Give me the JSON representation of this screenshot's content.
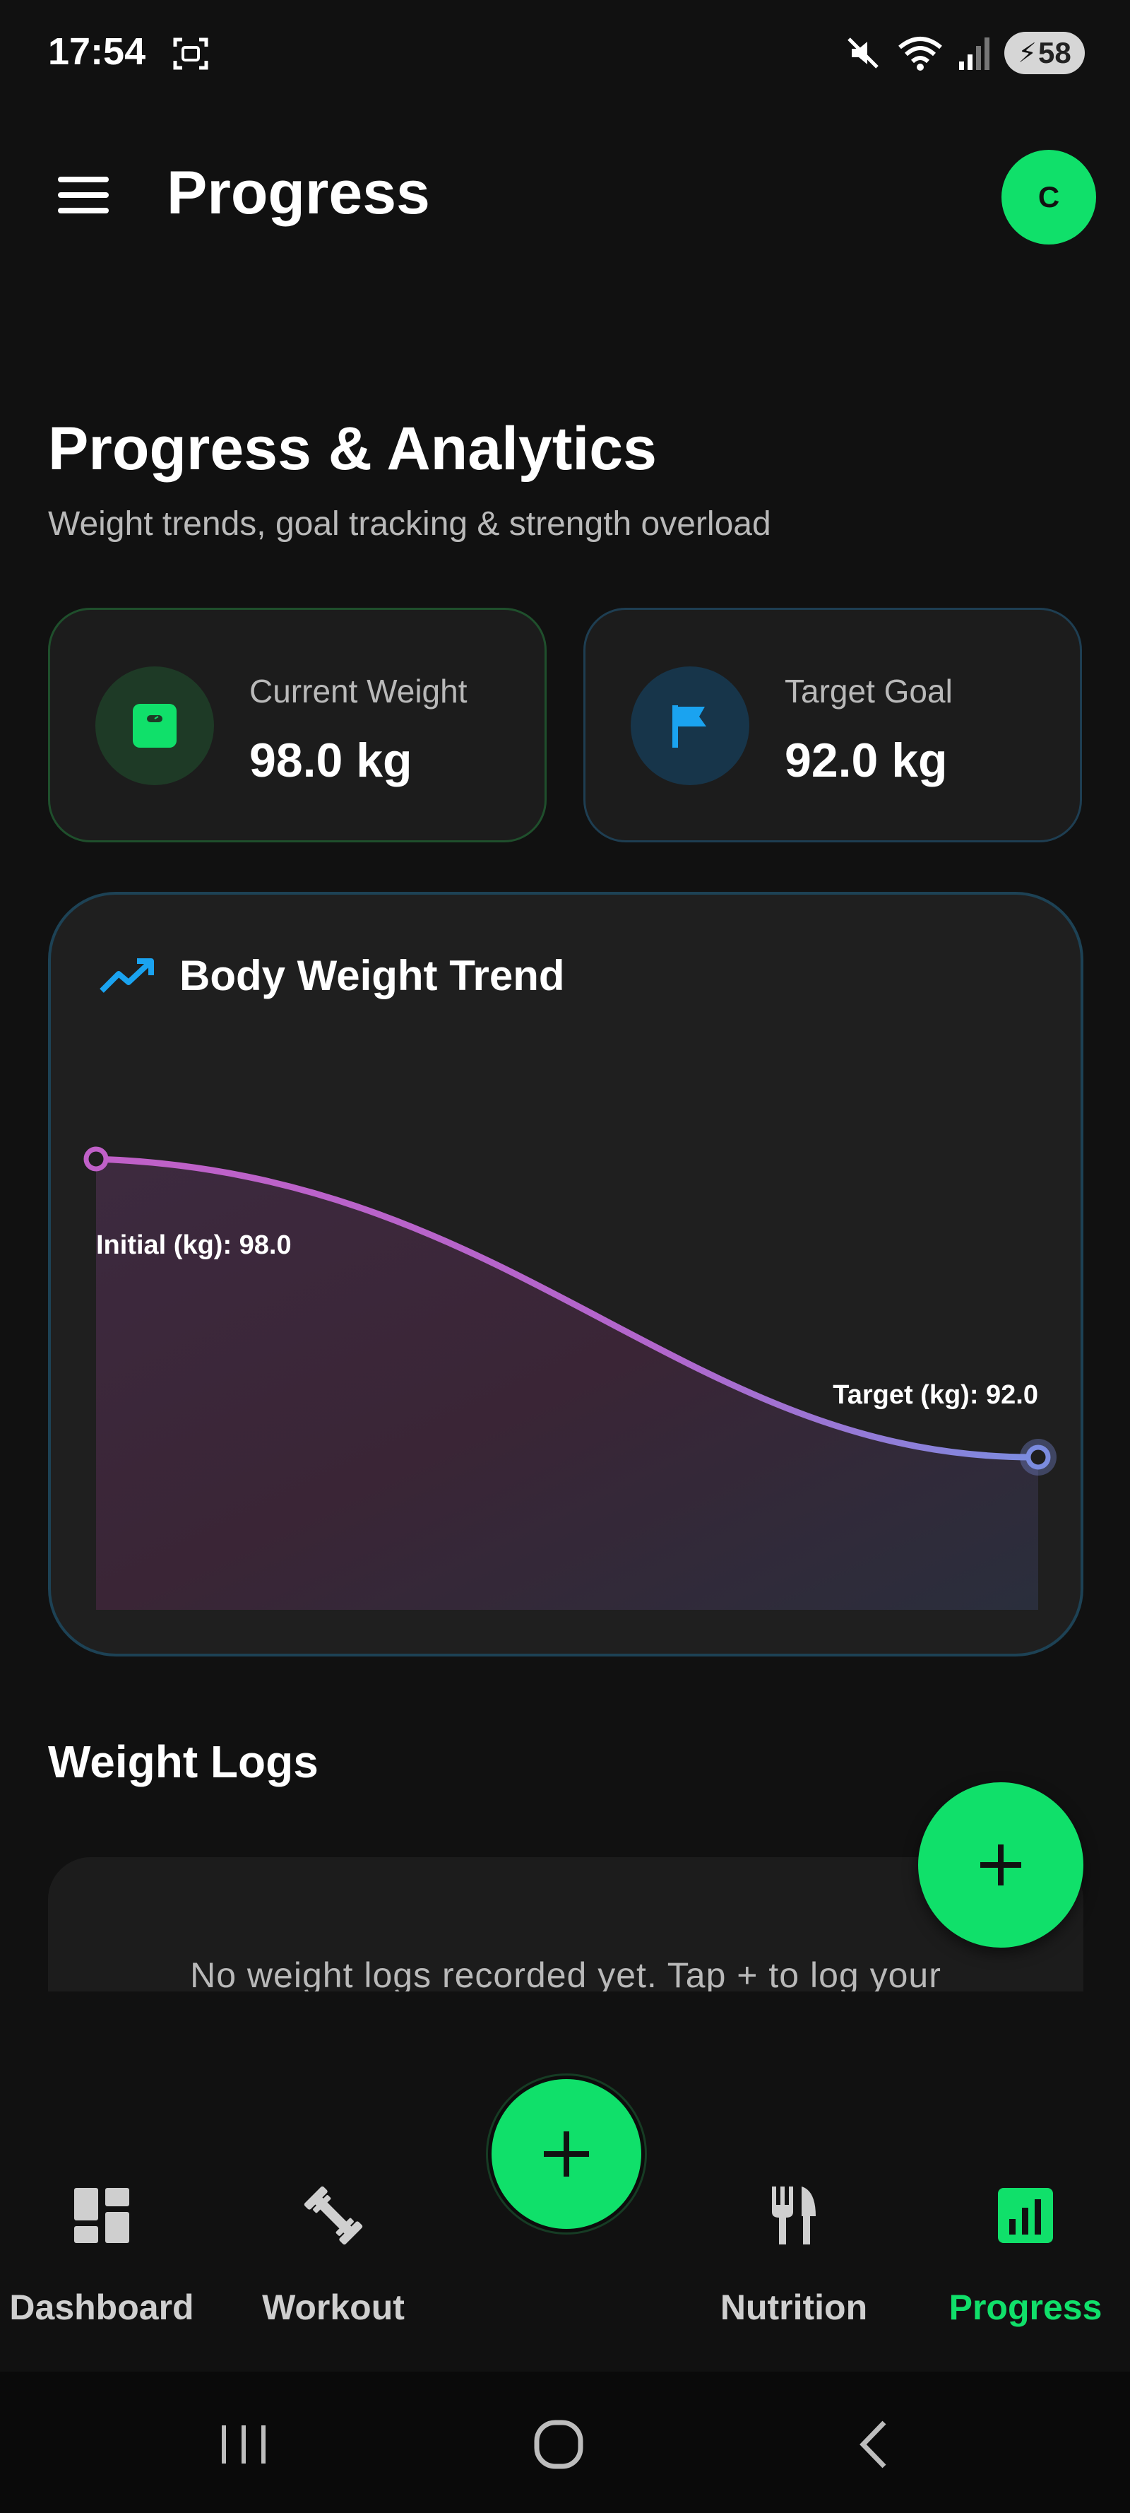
{
  "status_bar": {
    "time": "17:54",
    "battery": "58"
  },
  "app_bar": {
    "title": "Progress",
    "avatar_initial": "C"
  },
  "header": {
    "title": "Progress & Analytics",
    "subtitle": "Weight trends, goal tracking & strength overload"
  },
  "stats": {
    "current": {
      "label": "Current Weight",
      "value": "98.0 kg",
      "icon": "scale-icon",
      "color": "#10e06a"
    },
    "goal": {
      "label": "Target Goal",
      "value": "92.0 kg",
      "icon": "flag-icon",
      "color": "#1aa3f0"
    }
  },
  "chart": {
    "title": "Body Weight Trend"
  },
  "chart_data": {
    "type": "area",
    "title": "Body Weight Trend",
    "series": [
      {
        "name": "",
        "points": [
          {
            "label": "Initial (kg): 98.0",
            "y": 98.0
          },
          {
            "label": "Target (kg): 92.0",
            "y": 92.0
          }
        ]
      }
    ],
    "gradient": [
      "#c060c8",
      "#7b8ce0"
    ],
    "grid": false,
    "legend": "none"
  },
  "logs": {
    "title": "Weight Logs",
    "empty_text": "No weight logs recorded yet. Tap + to log your"
  },
  "nav": {
    "items": [
      {
        "label": "Dashboard",
        "icon": "dashboard-icon"
      },
      {
        "label": "Workout",
        "icon": "dumbbell-icon"
      },
      {
        "label": "Nutrition",
        "icon": "cutlery-icon"
      },
      {
        "label": "Progress",
        "icon": "bar-chart-icon"
      }
    ],
    "active": "Progress",
    "accent": "#10e06a"
  }
}
